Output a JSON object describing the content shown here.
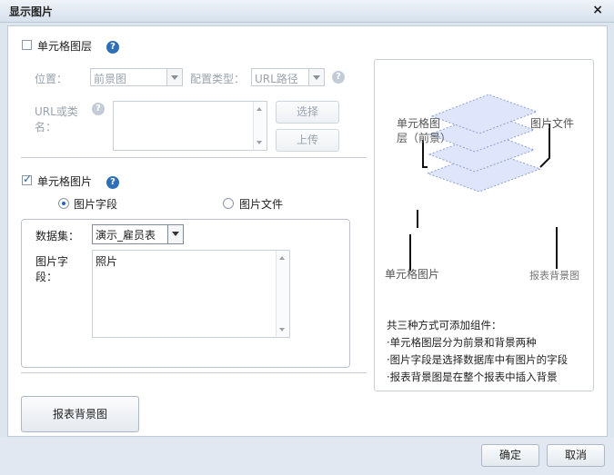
{
  "dialog": {
    "title": "显示图片",
    "close_glyph": "×"
  },
  "cell_layer": {
    "checkbox_label": "单元格图层",
    "checked": false,
    "help_glyph": "?",
    "position_label": "位置：",
    "position_value": "前景图",
    "config_type_label": "配置类型：",
    "config_type_value": "URL路径",
    "url_label_line1": "URL或类",
    "url_label_line2": "名：",
    "select_button": "选择",
    "upload_button": "上传"
  },
  "cell_image": {
    "checkbox_label": "单元格图片",
    "checked": true,
    "help_glyph": "?",
    "radio_field_label": "图片字段",
    "radio_file_label": "图片文件",
    "selected": "图片字段",
    "dataset_label": "数据集：",
    "dataset_value": "演示_雇员表",
    "field_label_line1": "图片字",
    "field_label_line2": "段：",
    "field_value": "照片"
  },
  "report_bg_button": "报表背景图",
  "diagram": {
    "label_cell_layer_line1": "单元格图",
    "label_cell_layer_line2": "层（前景）",
    "label_image_file": "图片文件",
    "label_cell_image": "单元格图片",
    "label_report_bg": "报表背景图",
    "notes": [
      "共三种方式可添加组件：",
      "·单元格图层分为前景和背景两种",
      "·图片字段是选择数据库中有图片的字段",
      "·报表背景图是在整个报表中插入背景"
    ]
  },
  "footer": {
    "ok": "确定",
    "cancel": "取消"
  }
}
